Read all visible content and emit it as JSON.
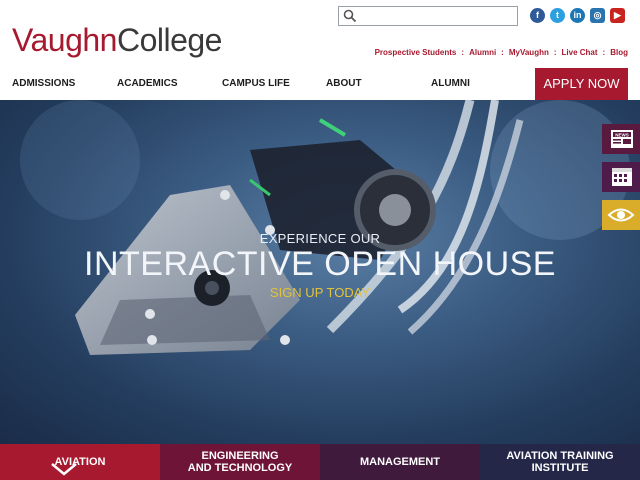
{
  "brand": {
    "part1": "Vaughn",
    "part2": "College"
  },
  "search": {
    "placeholder": "",
    "value": ""
  },
  "social": [
    {
      "icon": "facebook-icon",
      "glyph": "f"
    },
    {
      "icon": "twitter-icon",
      "glyph": "t"
    },
    {
      "icon": "linkedin-icon",
      "glyph": "in"
    },
    {
      "icon": "instagram-icon",
      "glyph": "◎"
    },
    {
      "icon": "youtube-icon",
      "glyph": "▶"
    }
  ],
  "utility": [
    "Prospective Students",
    "Alumni",
    "MyVaughn",
    "Live Chat",
    "Blog"
  ],
  "utility_sep": ":",
  "nav": [
    "ADMISSIONS",
    "ACADEMICS",
    "CAMPUS LIFE",
    "ABOUT",
    "ALUMNI"
  ],
  "apply_label": "APPLY NOW",
  "hero": {
    "kicker": "EXPERIENCE OUR",
    "title": "INTERACTIVE OPEN HOUSE",
    "cta": "SIGN UP TODAY"
  },
  "side_buttons": [
    {
      "icon": "news-icon",
      "label": "NEWS"
    },
    {
      "icon": "calendar-icon"
    },
    {
      "icon": "eye-icon"
    }
  ],
  "tabs": [
    {
      "line1": "AVIATION",
      "line2": ""
    },
    {
      "line1": "ENGINEERING",
      "line2": "AND TECHNOLOGY"
    },
    {
      "line1": "MANAGEMENT",
      "line2": ""
    },
    {
      "line1": "AVIATION TRAINING",
      "line2": "INSTITUTE"
    }
  ],
  "colors": {
    "brand": "#a6192e",
    "accent": "#d9ac2a",
    "cta": "#e4c33a"
  }
}
